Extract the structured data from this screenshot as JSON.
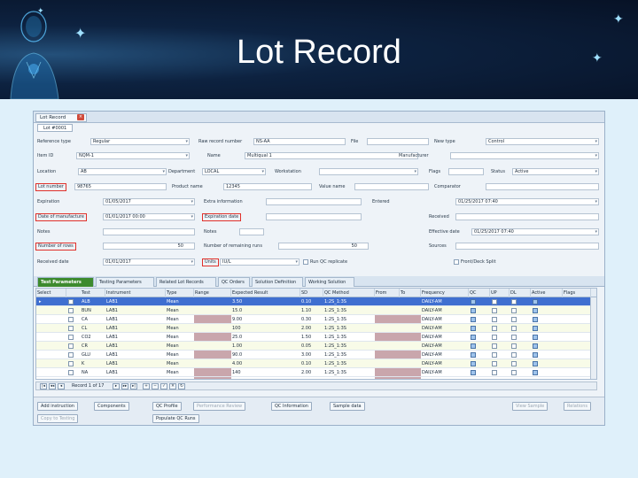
{
  "slide": {
    "title": "Lot Record"
  },
  "app": {
    "tab_label": "Lot Record",
    "subtab_label": "Lot #0001",
    "form": {
      "labels": {
        "reference_type": "Reference type",
        "row_record_number": "Raw record number",
        "file": "File",
        "new_type": "New type",
        "item_id": "Item ID",
        "name": "Name",
        "manufacturer": "Manufacturer",
        "location": "Location",
        "department": "Department",
        "workstation": "Workstation",
        "flags": "Flags",
        "status": "Status",
        "lot_number": "Lot number",
        "product_name": "Product name",
        "value_name": "Value name",
        "comparator": "Comparator",
        "expiration": "Expiration",
        "extra_info_1": "Extra information",
        "entered": "Entered",
        "date_of_manufacture": "Date of manufacture",
        "expiration_date": "Expiration date",
        "row_extra": "",
        "received": "Received",
        "notes": "Notes",
        "notes2": "Notes",
        "effective": "Effective date",
        "number_of_rows": "Number of rows",
        "number_of_runs": "Number of remaining runs",
        "sources": "Sources",
        "received_date": "Received date",
        "units": "Units"
      },
      "values": {
        "reference_type": "Regular",
        "row_record_number": "NS-AA",
        "file": "",
        "new_type": "Control",
        "item_id": "NQM-1",
        "name": "Multiqual 1",
        "manufacturer": "",
        "location": "AB",
        "department": "LOCAL",
        "workstation": "",
        "flags": "",
        "status": "Active",
        "lot_number": "98765",
        "product_name": "12345",
        "value_name": "",
        "comparator": "",
        "expiration": "01/05/2017",
        "extra_info_1": "",
        "entered": "01/25/2017 07:40",
        "date_of_manufacture": "01/01/2017 00:00",
        "expiration_date": "",
        "row_extra": "",
        "received": "",
        "effective": "01/25/2017 07:40",
        "number_of_rows": "50",
        "number_of_runs": "50",
        "sources": "",
        "received_date": "01/01/2017",
        "units": "IU/L",
        "run_qc_replicate": "Run QC replicate",
        "front_deck_split": "Front/Deck Split"
      }
    },
    "grid_tabs": [
      "Test Parameters",
      "Testing Parameters",
      "Related Lot Records",
      "QC Orders",
      "Solution Definition",
      "Working Solution"
    ],
    "grid": {
      "headers": [
        "Select",
        "Test",
        "Instrument",
        "Type",
        "Range",
        "Expected Result",
        "SD",
        "QC Method",
        "From",
        "To",
        "Frequency",
        "QC",
        "UP",
        "DL",
        "Active",
        "Flags"
      ],
      "rows": [
        {
          "test": "ALB",
          "instrument": "LAB1",
          "type": "Mean",
          "expected": "3.50",
          "sd": "0.10",
          "method": "1:2S_1:3S",
          "frequency": "DAILY-AM"
        },
        {
          "test": "BUN",
          "instrument": "LAB1",
          "type": "Mean",
          "expected": "15.0",
          "sd": "1.10",
          "method": "1:2S_1:3S",
          "frequency": "DAILY-AM"
        },
        {
          "test": "CA",
          "instrument": "LAB1",
          "type": "Mean",
          "expected": "9.00",
          "sd": "0.30",
          "method": "1:2S_1:3S",
          "frequency": "DAILY-AM"
        },
        {
          "test": "CL",
          "instrument": "LAB1",
          "type": "Mean",
          "expected": "100",
          "sd": "2.00",
          "method": "1:2S_1:3S",
          "frequency": "DAILY-AM"
        },
        {
          "test": "CO2",
          "instrument": "LAB1",
          "type": "Mean",
          "expected": "25.0",
          "sd": "1.50",
          "method": "1:2S_1:3S",
          "frequency": "DAILY-AM"
        },
        {
          "test": "CR",
          "instrument": "LAB1",
          "type": "Mean",
          "expected": "1.00",
          "sd": "0.05",
          "method": "1:2S_1:3S",
          "frequency": "DAILY-AM"
        },
        {
          "test": "GLU",
          "instrument": "LAB1",
          "type": "Mean",
          "expected": "90.0",
          "sd": "3.00",
          "method": "1:2S_1:3S",
          "frequency": "DAILY-AM"
        },
        {
          "test": "K",
          "instrument": "LAB1",
          "type": "Mean",
          "expected": "4.00",
          "sd": "0.10",
          "method": "1:2S_1:3S",
          "frequency": "DAILY-AM"
        },
        {
          "test": "NA",
          "instrument": "LAB1",
          "type": "Mean",
          "expected": "140",
          "sd": "2.00",
          "method": "1:2S_1:3S",
          "frequency": "DAILY-AM"
        }
      ]
    },
    "pager": {
      "text": "Record 1 of 17"
    },
    "toolbar": {
      "add_instruction": "Add instruction",
      "components": "Components",
      "qc_profile": "QC Profile",
      "performance_review": "Performance Review",
      "qc_information": "QC Information",
      "sample_data": "Sample data",
      "copy_to_testing": "Copy to Testing",
      "populate_qc_runs": "Populate QC Runs",
      "view_sample": "View Sample",
      "relations": "Relations"
    }
  }
}
